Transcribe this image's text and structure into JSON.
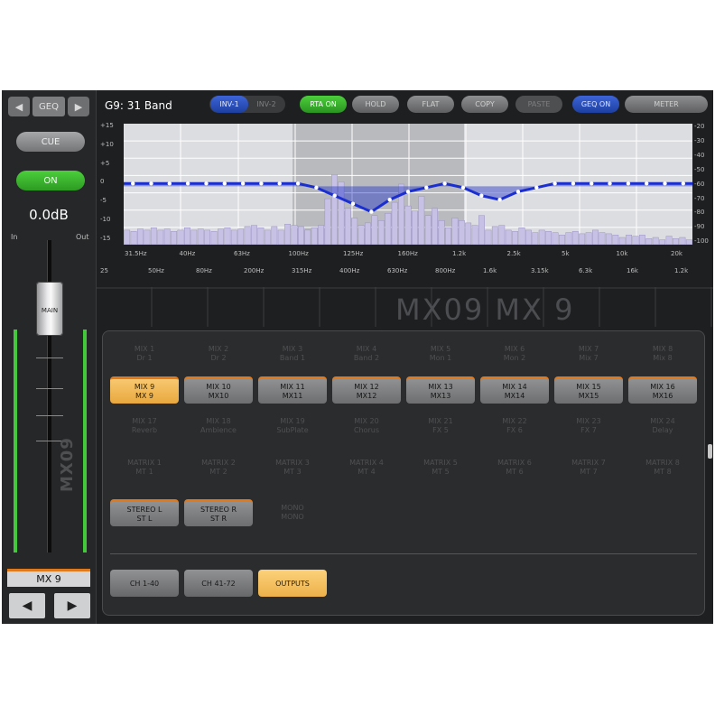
{
  "left": {
    "geq_label": "GEQ",
    "cue_label": "CUE",
    "on_label": "ON",
    "gain": "0.0dB",
    "in_label": "In",
    "out_label": "Out",
    "fader_cap_label": "MAIN",
    "vertical_name": "MX09",
    "channel_name": "MX 9",
    "prev_arrow": "◀",
    "next_arrow": "▶"
  },
  "toolbar": {
    "title": "G9: 31 Band",
    "inv1": "INV-1",
    "inv2": "INV-2",
    "rta_on": "RTA ON",
    "hold": "HOLD",
    "flat": "FLAT",
    "copy": "COPY",
    "paste": "PASTE",
    "geq_on": "GEQ ON",
    "meter": "METER"
  },
  "graph": {
    "left_scale": [
      "+15",
      "+10",
      "+5",
      "0",
      "-5",
      "-10",
      "-15"
    ],
    "right_scale": [
      "-20",
      "-30",
      "-40",
      "-50",
      "-60",
      "-70",
      "-80",
      "-90",
      "-100"
    ],
    "freq_top": [
      "31.5Hz",
      "40Hz",
      "63Hz",
      "100Hz",
      "125Hz",
      "160Hz",
      "1.2k",
      "2.5k",
      "5k",
      "10k",
      "20k"
    ],
    "freq_bottom": [
      "25",
      "50Hz",
      "80Hz",
      "200Hz",
      "315Hz",
      "400Hz",
      "630Hz",
      "800Hz",
      "1.6k",
      "3.15k",
      "6.3k",
      "16k",
      "1.2k"
    ],
    "colors": {
      "curve": "#1b2fd0",
      "bars": "#c7c1e6",
      "graph_bg": "#dcdde0"
    },
    "band_gains_db": [
      0,
      0,
      0,
      0,
      0,
      0,
      0,
      0,
      0,
      0,
      -1,
      -3,
      -5,
      -7,
      -4,
      -2,
      -1,
      0,
      -1,
      -3,
      -4,
      -2,
      -1,
      0,
      0,
      0,
      0,
      0,
      0,
      0,
      0
    ],
    "rta_levels": [
      0.12,
      0.11,
      0.13,
      0.12,
      0.14,
      0.12,
      0.13,
      0.11,
      0.12,
      0.14,
      0.12,
      0.13,
      0.12,
      0.11,
      0.13,
      0.14,
      0.12,
      0.13,
      0.15,
      0.16,
      0.14,
      0.12,
      0.15,
      0.12,
      0.17,
      0.16,
      0.15,
      0.12,
      0.14,
      0.16,
      0.38,
      0.58,
      0.52,
      0.3,
      0.22,
      0.16,
      0.18,
      0.24,
      0.2,
      0.26,
      0.35,
      0.5,
      0.32,
      0.28,
      0.4,
      0.24,
      0.3,
      0.2,
      0.14,
      0.22,
      0.2,
      0.18,
      0.16,
      0.24,
      0.12,
      0.15,
      0.16,
      0.12,
      0.11,
      0.14,
      0.12,
      0.1,
      0.12,
      0.11,
      0.1,
      0.08,
      0.1,
      0.11,
      0.09,
      0.1,
      0.12,
      0.1,
      0.09,
      0.08,
      0.06,
      0.08,
      0.07,
      0.08,
      0.05,
      0.06,
      0.04,
      0.07,
      0.05,
      0.06,
      0.04
    ]
  },
  "banner": {
    "text": "MX09 MX 9"
  },
  "selector": {
    "rows": [
      [
        {
          "line1": "MIX 1",
          "line2": "Dr 1",
          "state": "dim"
        },
        {
          "line1": "MIX 2",
          "line2": "Dr 2",
          "state": "dim"
        },
        {
          "line1": "MIX 3",
          "line2": "Band 1",
          "state": "dim"
        },
        {
          "line1": "MIX 4",
          "line2": "Band 2",
          "state": "dim"
        },
        {
          "line1": "MIX 5",
          "line2": "Mon 1",
          "state": "dim"
        },
        {
          "line1": "MIX 6",
          "line2": "Mon 2",
          "state": "dim"
        },
        {
          "line1": "MIX 7",
          "line2": "Mix 7",
          "state": "dim"
        },
        {
          "line1": "MIX 8",
          "line2": "Mix 8",
          "state": "dim"
        }
      ],
      [
        {
          "line1": "MIX 9",
          "line2": "MX 9",
          "state": "act"
        },
        {
          "line1": "MIX 10",
          "line2": "MX10",
          "state": "sel"
        },
        {
          "line1": "MIX 11",
          "line2": "MX11",
          "state": "sel"
        },
        {
          "line1": "MIX 12",
          "line2": "MX12",
          "state": "sel"
        },
        {
          "line1": "MIX 13",
          "line2": "MX13",
          "state": "sel"
        },
        {
          "line1": "MIX 14",
          "line2": "MX14",
          "state": "sel"
        },
        {
          "line1": "MIX 15",
          "line2": "MX15",
          "state": "sel"
        },
        {
          "line1": "MIX 16",
          "line2": "MX16",
          "state": "sel"
        }
      ],
      [
        {
          "line1": "MIX 17",
          "line2": "Reverb",
          "state": "dim"
        },
        {
          "line1": "MIX 18",
          "line2": "Ambience",
          "state": "dim"
        },
        {
          "line1": "MIX 19",
          "line2": "SubPlate",
          "state": "dim"
        },
        {
          "line1": "MIX 20",
          "line2": "Chorus",
          "state": "dim"
        },
        {
          "line1": "MIX 21",
          "line2": "FX 5",
          "state": "dim"
        },
        {
          "line1": "MIX 22",
          "line2": "FX 6",
          "state": "dim"
        },
        {
          "line1": "MIX 23",
          "line2": "FX 7",
          "state": "dim"
        },
        {
          "line1": "MIX 24",
          "line2": "Delay",
          "state": "dim"
        }
      ],
      [
        {
          "line1": "MATRIX 1",
          "line2": "MT 1",
          "state": "dim"
        },
        {
          "line1": "MATRIX 2",
          "line2": "MT 2",
          "state": "dim"
        },
        {
          "line1": "MATRIX 3",
          "line2": "MT 3",
          "state": "dim"
        },
        {
          "line1": "MATRIX 4",
          "line2": "MT 4",
          "state": "dim"
        },
        {
          "line1": "MATRIX 5",
          "line2": "MT 5",
          "state": "dim"
        },
        {
          "line1": "MATRIX 6",
          "line2": "MT 6",
          "state": "dim"
        },
        {
          "line1": "MATRIX 7",
          "line2": "MT 7",
          "state": "dim"
        },
        {
          "line1": "MATRIX 8",
          "line2": "MT 8",
          "state": "dim"
        }
      ],
      [
        {
          "line1": "STEREO L",
          "line2": "ST L",
          "state": "sel"
        },
        {
          "line1": "STEREO R",
          "line2": "ST R",
          "state": "sel"
        },
        {
          "line1": "MONO",
          "line2": "MONO",
          "state": "dim"
        }
      ]
    ],
    "bottom": [
      {
        "label": "CH 1-40",
        "state": "grey"
      },
      {
        "label": "CH 41-72",
        "state": "grey"
      },
      {
        "label": "OUTPUTS",
        "state": "act"
      }
    ]
  }
}
